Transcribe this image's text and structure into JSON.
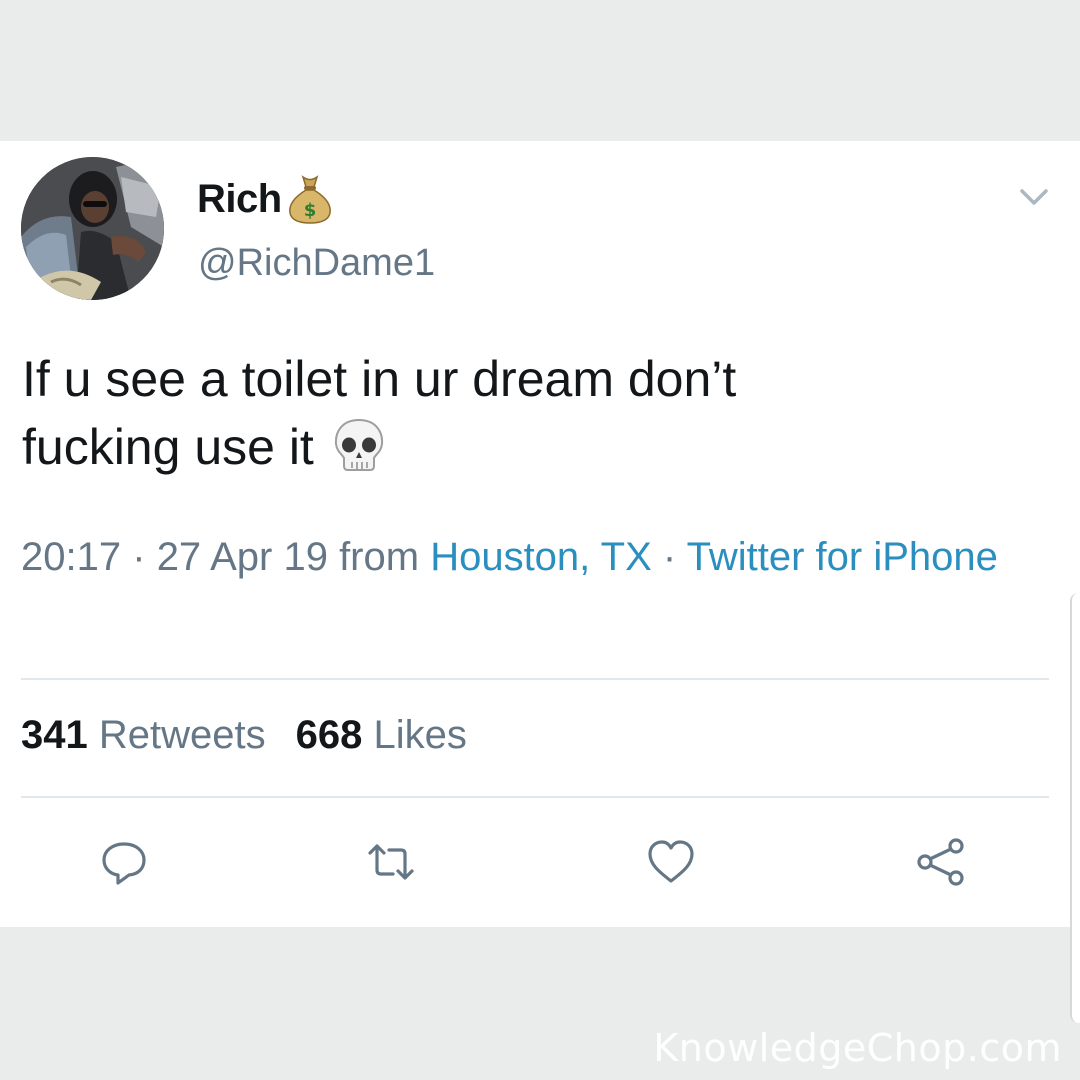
{
  "tweet": {
    "author_name": "Rich",
    "author_emoji": "money-bag-emoji",
    "handle": "@RichDame1",
    "text_line1": "If u see a toilet in ur dream don’t",
    "text_line2": "fucking use it",
    "text_emoji": "skull-emoji",
    "time": "20:17",
    "date": "27 Apr 19",
    "from_label": "from",
    "location": "Houston, TX",
    "separator": "·",
    "source": "Twitter for iPhone",
    "retweets_count": "341",
    "retweets_label": "Retweets",
    "likes_count": "668",
    "likes_label": "Likes"
  },
  "icons": {
    "menu": "chevron-down-icon",
    "reply": "reply-icon",
    "retweet": "retweet-icon",
    "like": "heart-icon",
    "share": "share-icon"
  },
  "colors": {
    "text": "#14171a",
    "secondary": "#657786",
    "link": "#2a8fbf",
    "background": "#eaecec"
  },
  "watermark": "KnowledgeChop.com"
}
